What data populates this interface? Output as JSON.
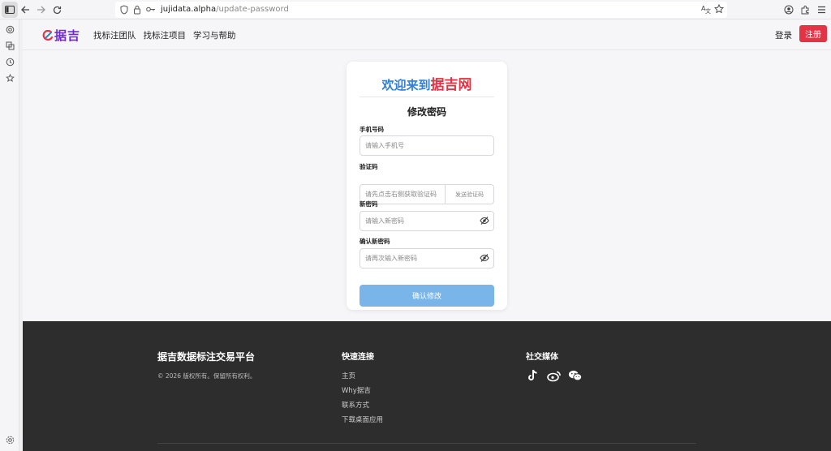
{
  "browser": {
    "url_host": "jujidata.alpha",
    "url_path": "/update-password",
    "icons": [
      "sidebar-toggle-icon",
      "back-icon",
      "forward-icon",
      "reload-icon",
      "shield-icon",
      "lock-icon",
      "key-icon",
      "translate-icon",
      "star-icon",
      "account-icon",
      "extensions-icon",
      "menu-icon"
    ]
  },
  "sidebar": {
    "icons": [
      "ai-icon",
      "history-icon",
      "clock-icon",
      "bookmark-icon",
      "settings-icon"
    ]
  },
  "header": {
    "logo_text": "据吉",
    "nav": [
      "找标注团队",
      "找标注项目",
      "学习与帮助"
    ],
    "login": "登录",
    "register": "注册"
  },
  "card": {
    "welcome_prefix": "欢迎来到",
    "welcome_brand": "据吉网",
    "title": "修改密码",
    "phone_label": "手机号码",
    "phone_placeholder": "请输入手机号",
    "code_label": "验证码",
    "code_placeholder": "请先点击右侧获取验证码",
    "send_code": "发送验证码",
    "new_password_label": "新密码",
    "new_password_placeholder": "请输入新密码",
    "confirm_password_label": "确认新密码",
    "confirm_password_placeholder": "请再次输入新密码",
    "submit": "确认修改"
  },
  "footer": {
    "brand": "据吉数据标注交易平台",
    "copyright": "© 2026 版权所有。保留所有权利。",
    "quick_links_title": "快速连接",
    "links": [
      "主页",
      "Why据吉",
      "联系方式",
      "下载桌面应用"
    ],
    "social_title": "社交媒体",
    "social_icons": [
      "tiktok-icon",
      "weibo-icon",
      "wechat-icon"
    ]
  },
  "colors": {
    "brand_red": "#e53346",
    "brand_blue": "#2f80d6",
    "brand_purple": "#6d2ad6",
    "button_blue": "#7ab5ea",
    "footer_bg": "#2d2d2d"
  }
}
